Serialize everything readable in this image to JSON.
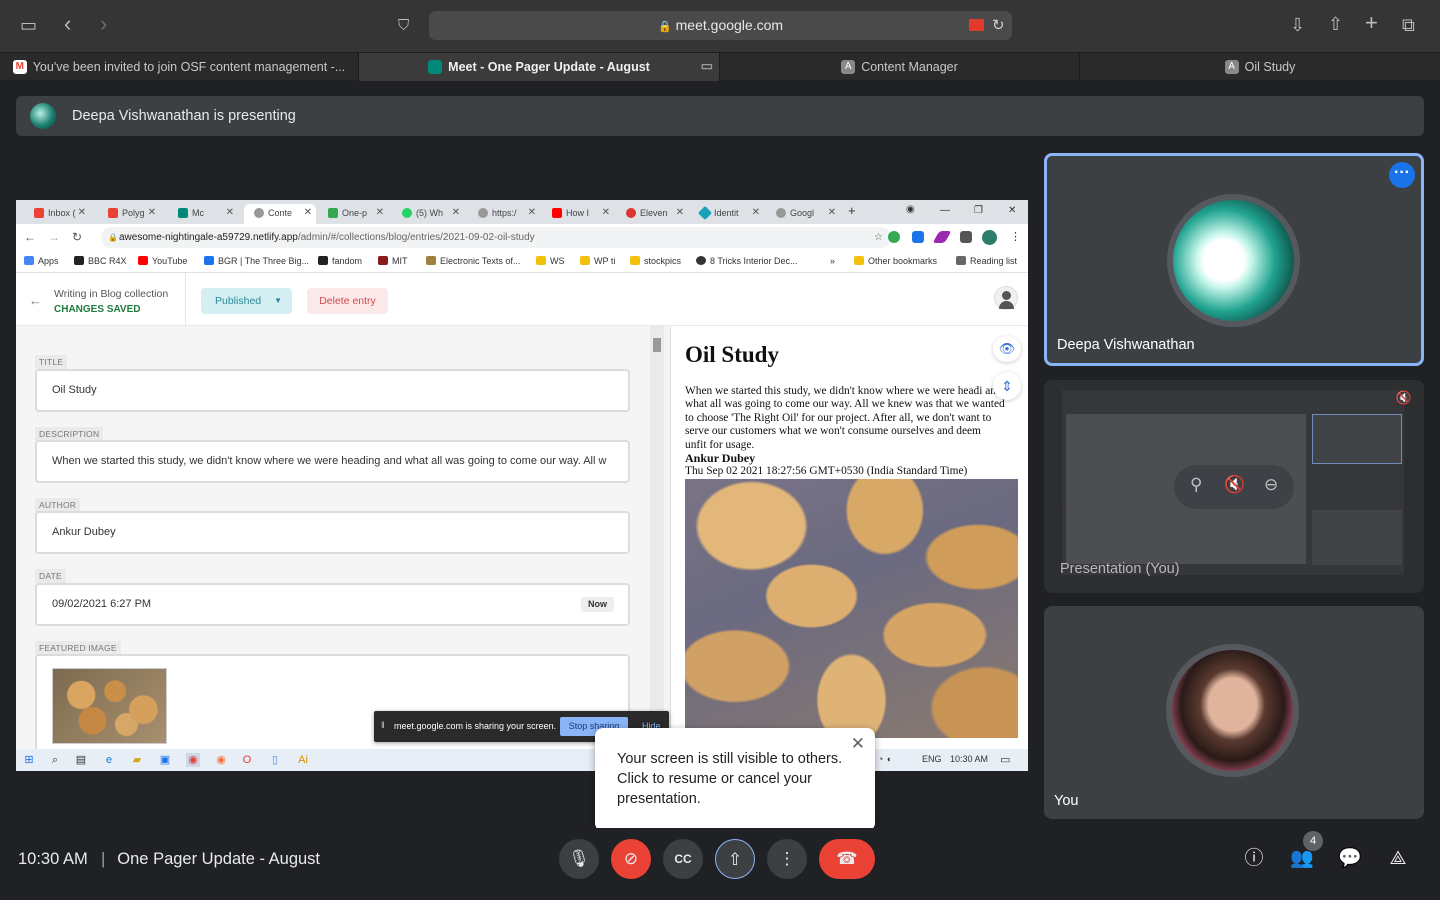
{
  "browser": {
    "url": "meet.google.com",
    "tabs": [
      {
        "label": "You've been invited to join OSF content management -...",
        "icon": "gmail-icon",
        "active": false
      },
      {
        "label": "Meet - One Pager Update - August",
        "icon": "meet-icon",
        "active": true
      },
      {
        "label": "Content Manager",
        "icon": "cms-icon",
        "active": false
      },
      {
        "label": "Oil Study",
        "icon": "cms-icon",
        "active": false
      }
    ]
  },
  "meet": {
    "presenting_banner": "Deepa Vishwanathan is presenting",
    "tooltip": "Your screen is still visible to others. Click to resume or cancel your presentation.",
    "clock": "10:30 AM",
    "meeting_title": "One Pager Update - August",
    "participant_count": "4",
    "tiles": {
      "deepa": "Deepa Vishwanathan",
      "presentation": "Presentation (You)",
      "you": "You"
    },
    "colors": {
      "accent": "#8ab4f8",
      "danger": "#ea4335",
      "background": "#202124",
      "tile": "#3c4043"
    }
  },
  "shared_screen": {
    "chrome_tabs": [
      "Inbox (",
      "Polyg",
      "Mc",
      "Conte",
      "One-p",
      "(5) Wh",
      "https:/",
      "How I",
      "Eleven",
      "Identit",
      "Googl"
    ],
    "url_host": "awesome-nightingale-a59729.netlify.app",
    "url_path": "/admin/#/collections/blog/entries/2021-09-02-oil-study",
    "bookmarks": [
      "Apps",
      "BBC R4X",
      "YouTube",
      "BGR | The Three Big...",
      "fandom",
      "MIT",
      "Electronic Texts of...",
      "WS",
      "WP ti",
      "stockpics",
      "8 Tricks Interior Dec...",
      "»",
      "Other bookmarks",
      "Reading list"
    ],
    "cms": {
      "collection": "Writing in Blog collection",
      "status": "CHANGES SAVED",
      "publish_label": "Published",
      "delete_label": "Delete entry",
      "fields": {
        "title_label": "TITLE",
        "title": "Oil Study",
        "description_label": "DESCRIPTION",
        "description": "When we started this study, we didn't know where we were heading and what all was going to come our way. All w",
        "author_label": "AUTHOR",
        "author": "Ankur Dubey",
        "date_label": "DATE",
        "date": "09/02/2021 6:27 PM",
        "now_label": "Now",
        "image_label": "FEATURED IMAGE"
      }
    },
    "preview": {
      "title": "Oil Study",
      "body": "When we started this study, we didn't know where we were headi and what all was going to come our way. All we knew was that we wanted to choose 'The Right Oil' for our project. After all, we don't want to serve our customers what we won't consume ourselves and deem unfit for usage.",
      "author": "Ankur Dubey",
      "date": "Thu Sep 02 2021 18:27:56 GMT+0530 (India Standard Time)"
    },
    "share_bar": {
      "text": "meet.google.com is sharing your screen.",
      "stop": "Stop sharing",
      "hide": "Hide"
    },
    "taskbar": {
      "lang": "ENG",
      "time": "10:30 AM"
    }
  }
}
